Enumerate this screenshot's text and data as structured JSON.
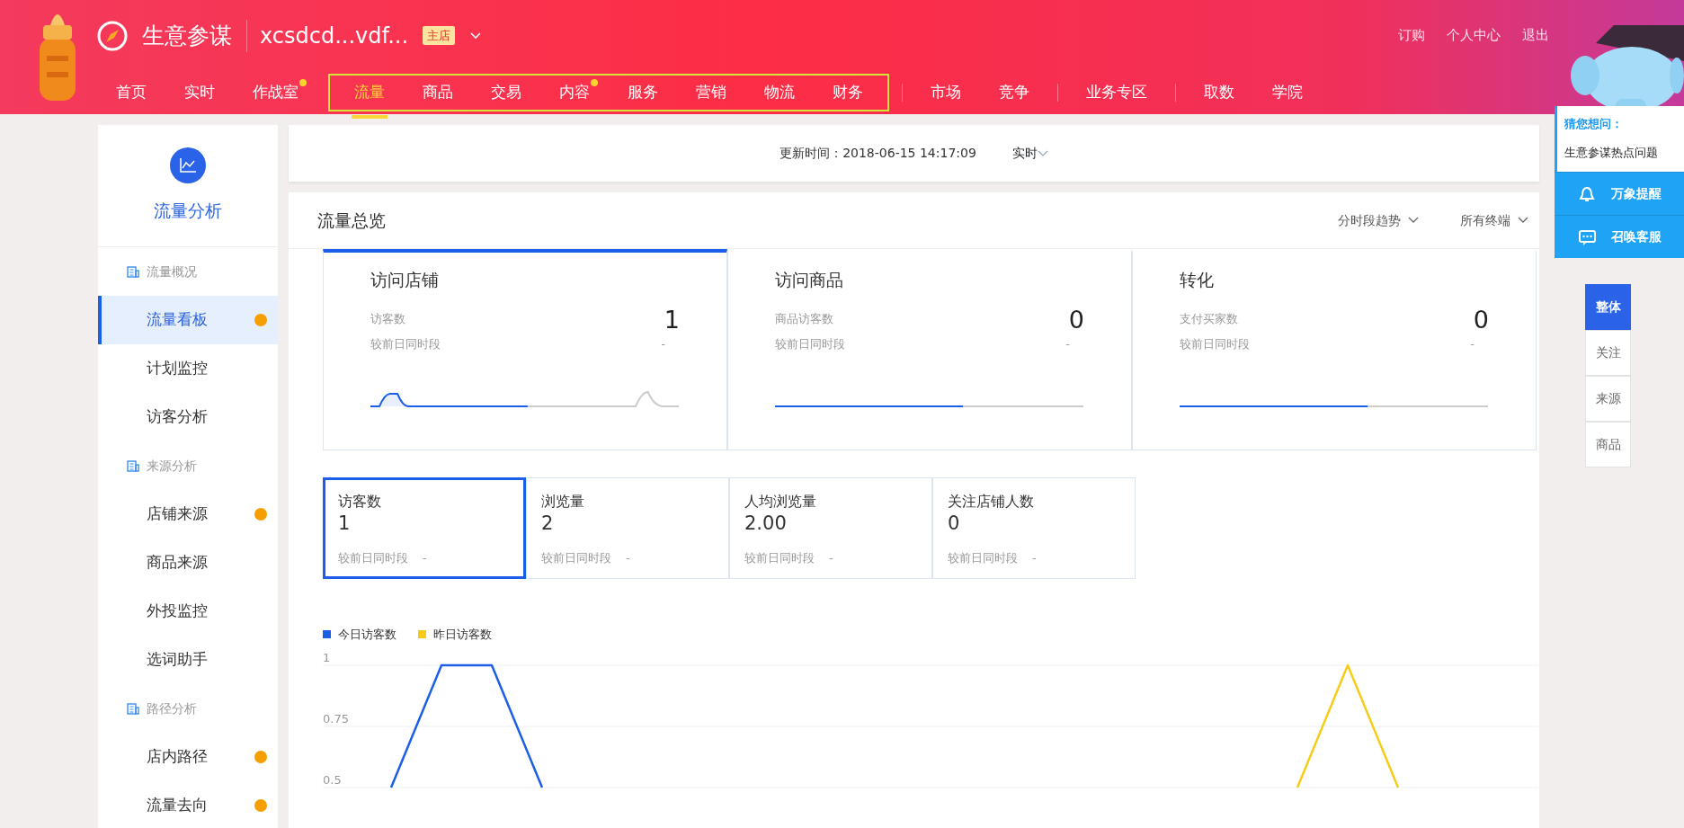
{
  "header": {
    "title": "生意参谋",
    "store": "xcsdcd...vdf...",
    "store_badge": "主店",
    "top_links": [
      "订购",
      "个人中心",
      "退出"
    ],
    "nav_groups": [
      {
        "outlined": false,
        "items": [
          {
            "label": "首页",
            "selected": false,
            "dot": false
          },
          {
            "label": "实时",
            "selected": false,
            "dot": false
          },
          {
            "label": "作战室",
            "selected": false,
            "dot": true
          }
        ]
      },
      {
        "outlined": true,
        "items": [
          {
            "label": "流量",
            "selected": true,
            "dot": false
          },
          {
            "label": "商品",
            "selected": false,
            "dot": false
          },
          {
            "label": "交易",
            "selected": false,
            "dot": false
          },
          {
            "label": "内容",
            "selected": false,
            "dot": true
          },
          {
            "label": "服务",
            "selected": false,
            "dot": false
          },
          {
            "label": "营销",
            "selected": false,
            "dot": false
          },
          {
            "label": "物流",
            "selected": false,
            "dot": false
          },
          {
            "label": "财务",
            "selected": false,
            "dot": false
          }
        ]
      },
      {
        "outlined": false,
        "items": [
          {
            "label": "市场",
            "selected": false,
            "dot": false
          },
          {
            "label": "竞争",
            "selected": false,
            "dot": false
          }
        ]
      },
      {
        "outlined": false,
        "items": [
          {
            "label": "业务专区",
            "selected": false,
            "dot": false
          }
        ]
      },
      {
        "outlined": false,
        "items": [
          {
            "label": "取数",
            "selected": false,
            "dot": false
          },
          {
            "label": "学院",
            "selected": false,
            "dot": false
          }
        ]
      }
    ]
  },
  "sidebar": {
    "title": "流量分析",
    "sections": [
      {
        "heading": "流量概况",
        "items": [
          {
            "label": "流量看板",
            "selected": true,
            "dot": true
          },
          {
            "label": "计划监控",
            "selected": false,
            "dot": false
          },
          {
            "label": "访客分析",
            "selected": false,
            "dot": false
          }
        ]
      },
      {
        "heading": "来源分析",
        "items": [
          {
            "label": "店铺来源",
            "selected": false,
            "dot": true
          },
          {
            "label": "商品来源",
            "selected": false,
            "dot": false
          },
          {
            "label": "外投监控",
            "selected": false,
            "dot": false
          },
          {
            "label": "选词助手",
            "selected": false,
            "dot": false
          }
        ]
      },
      {
        "heading": "路径分析",
        "items": [
          {
            "label": "店内路径",
            "selected": false,
            "dot": true
          },
          {
            "label": "流量去向",
            "selected": false,
            "dot": true
          }
        ]
      }
    ]
  },
  "top_bar": {
    "update_time": "更新时间：2018-06-15 14:17:09",
    "mode": "实时"
  },
  "panel": {
    "title": "流量总览",
    "filters": [
      "分时段趋势",
      "所有终端"
    ],
    "summary_cards": [
      {
        "title": "访问店铺",
        "metric": "访客数",
        "value": "1",
        "compare_label": "较前日同时段",
        "compare_value": "-",
        "selected": true
      },
      {
        "title": "访问商品",
        "metric": "商品访客数",
        "value": "0",
        "compare_label": "较前日同时段",
        "compare_value": "-",
        "selected": false
      },
      {
        "title": "转化",
        "metric": "支付买家数",
        "value": "0",
        "compare_label": "较前日同时段",
        "compare_value": "-",
        "selected": false
      }
    ],
    "metric_tabs": [
      {
        "label": "访客数",
        "value": "1",
        "compare_label": "较前日同时段",
        "compare_value": "-",
        "selected": true
      },
      {
        "label": "浏览量",
        "value": "2",
        "compare_label": "较前日同时段",
        "compare_value": "-",
        "selected": false
      },
      {
        "label": "人均浏览量",
        "value": "2.00",
        "compare_label": "较前日同时段",
        "compare_value": "-",
        "selected": false
      },
      {
        "label": "关注店铺人数",
        "value": "0",
        "compare_label": "较前日同时段",
        "compare_value": "-",
        "selected": false
      }
    ],
    "chart_data": {
      "type": "line",
      "ylim": [
        0.5,
        1
      ],
      "yticks": [
        0.5,
        0.75,
        1
      ],
      "series": [
        {
          "name": "今日访客数",
          "color": "#1d5ee8",
          "values": [
            null,
            0.5,
            1,
            1,
            0.5,
            null,
            null,
            null,
            null,
            null,
            null,
            null,
            null,
            null,
            null
          ]
        },
        {
          "name": "昨日访客数",
          "color": "#f5cd19",
          "values": [
            null,
            null,
            null,
            null,
            null,
            null,
            null,
            null,
            null,
            null,
            null,
            null,
            null,
            null,
            null,
            null,
            null,
            null,
            null,
            0.5,
            1,
            0.5,
            null,
            null
          ]
        }
      ]
    }
  },
  "assistant": {
    "heading": "猜您想问：",
    "question": "生意参谋热点问题",
    "actions": [
      {
        "label": "万象提醒",
        "kind": "bell"
      },
      {
        "label": "召唤客服",
        "kind": "chat"
      }
    ]
  },
  "side_tabs": [
    {
      "label": "整体",
      "selected": true
    },
    {
      "label": "关注",
      "selected": false
    },
    {
      "label": "来源",
      "selected": false
    },
    {
      "label": "商品",
      "selected": false
    }
  ]
}
